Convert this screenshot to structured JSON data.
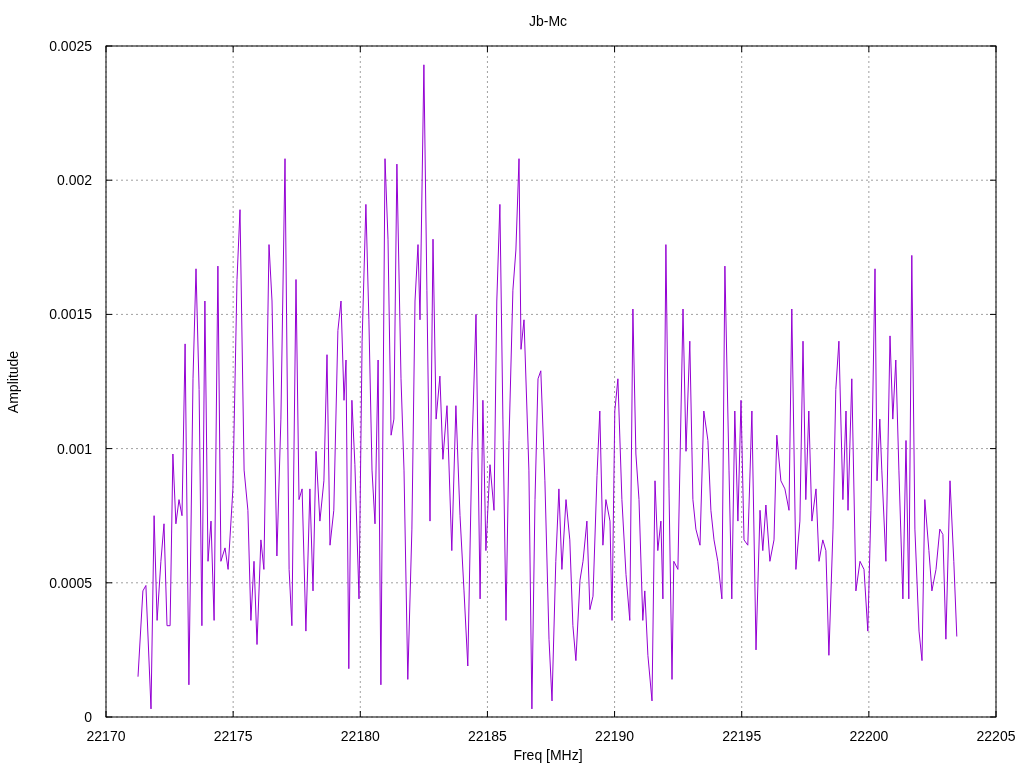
{
  "chart_data": {
    "type": "line",
    "title": "Jb-Mc",
    "xlabel": "Freq [MHz]",
    "ylabel": "Amplitude",
    "grid": true,
    "xlim": [
      22170,
      22205
    ],
    "ylim": [
      0,
      0.0025
    ],
    "xticks": [
      22170,
      22175,
      22180,
      22185,
      22190,
      22195,
      22200,
      22205
    ],
    "yticks": [
      0,
      0.0005,
      0.001,
      0.0015,
      0.002,
      0.0025
    ],
    "x": [
      22171.26,
      22171.45,
      22171.57,
      22171.77,
      22171.89,
      22172.01,
      22172.16,
      22172.28,
      22172.4,
      22172.52,
      22172.63,
      22172.75,
      22172.87,
      22172.99,
      22173.11,
      22173.26,
      22173.42,
      22173.54,
      22173.66,
      22173.77,
      22173.89,
      22174.01,
      22174.13,
      22174.25,
      22174.4,
      22174.52,
      22174.68,
      22174.8,
      22174.99,
      22175.15,
      22175.27,
      22175.43,
      22175.58,
      22175.7,
      22175.82,
      22175.94,
      22176.09,
      22176.21,
      22176.41,
      22176.53,
      22176.72,
      22176.88,
      22177.04,
      22177.2,
      22177.31,
      22177.47,
      22177.59,
      22177.71,
      22177.86,
      22178.02,
      22178.14,
      22178.26,
      22178.41,
      22178.57,
      22178.69,
      22178.81,
      22178.96,
      22179.12,
      22179.24,
      22179.36,
      22179.44,
      22179.55,
      22179.67,
      22179.79,
      22179.95,
      22180.07,
      22180.22,
      22180.34,
      22180.46,
      22180.58,
      22180.7,
      22180.81,
      22180.97,
      22181.09,
      22181.21,
      22181.32,
      22181.44,
      22181.6,
      22181.72,
      22181.87,
      22182.03,
      22182.15,
      22182.27,
      22182.35,
      22182.5,
      22182.62,
      22182.74,
      22182.86,
      22182.98,
      22183.13,
      22183.25,
      22183.41,
      22183.6,
      22183.76,
      22183.92,
      22184.08,
      22184.23,
      22184.39,
      22184.55,
      22184.71,
      22184.82,
      22184.94,
      22185.1,
      22185.26,
      22185.37,
      22185.49,
      22185.61,
      22185.73,
      22185.85,
      22186.0,
      22186.12,
      22186.24,
      22186.32,
      22186.44,
      22186.63,
      22186.75,
      22186.87,
      22186.99,
      22187.1,
      22187.26,
      22187.42,
      22187.54,
      22187.69,
      22187.81,
      22187.93,
      22188.09,
      22188.24,
      22188.36,
      22188.48,
      22188.64,
      22188.76,
      22188.91,
      22189.03,
      22189.15,
      22189.31,
      22189.42,
      22189.54,
      22189.66,
      22189.82,
      22189.9,
      22190.01,
      22190.13,
      22190.29,
      22190.45,
      22190.6,
      22190.72,
      22190.84,
      22190.96,
      22191.11,
      22191.19,
      22191.31,
      22191.47,
      22191.59,
      22191.7,
      22191.82,
      22191.9,
      22192.02,
      22192.14,
      22192.26,
      22192.33,
      22192.49,
      22192.69,
      22192.81,
      22192.96,
      22193.08,
      22193.2,
      22193.36,
      22193.51,
      22193.67,
      22193.79,
      22193.91,
      22194.06,
      22194.22,
      22194.34,
      22194.5,
      22194.61,
      22194.73,
      22194.85,
      22194.97,
      22195.09,
      22195.24,
      22195.4,
      22195.56,
      22195.72,
      22195.83,
      22195.95,
      22196.11,
      22196.27,
      22196.38,
      22196.54,
      22196.7,
      22196.86,
      22196.97,
      22197.13,
      22197.29,
      22197.41,
      22197.52,
      22197.64,
      22197.76,
      22197.92,
      22198.04,
      22198.19,
      22198.31,
      22198.43,
      22198.59,
      22198.7,
      22198.82,
      22198.98,
      22199.1,
      22199.18,
      22199.33,
      22199.49,
      22199.65,
      22199.81,
      22199.96,
      22200.08,
      22200.24,
      22200.32,
      22200.43,
      22200.51,
      22200.67,
      22200.83,
      22200.94,
      22201.06,
      22201.18,
      22201.34,
      22201.46,
      22201.57,
      22201.69,
      22201.81,
      22201.97,
      22202.09,
      22202.2,
      22202.36,
      22202.48,
      22202.64,
      22202.79,
      22202.91,
      22203.03,
      22203.19,
      22203.34,
      22203.46
    ],
    "series": [
      {
        "color": "#9400d3",
        "values": [
          0.00015,
          0.00047,
          0.00049,
          3e-05,
          0.00075,
          0.00036,
          0.00058,
          0.00072,
          0.00034,
          0.00034,
          0.00098,
          0.00072,
          0.00081,
          0.00075,
          0.00139,
          0.00012,
          0.00126,
          0.00167,
          0.00122,
          0.00034,
          0.00155,
          0.00058,
          0.00073,
          0.00036,
          0.00168,
          0.00058,
          0.00063,
          0.00055,
          0.00085,
          0.00163,
          0.00189,
          0.00092,
          0.00077,
          0.00036,
          0.00058,
          0.00027,
          0.00066,
          0.00055,
          0.00176,
          0.00155,
          0.0006,
          0.00111,
          0.00208,
          0.00055,
          0.00034,
          0.00163,
          0.00081,
          0.00085,
          0.00032,
          0.00085,
          0.00047,
          0.00099,
          0.00073,
          0.00088,
          0.00135,
          0.00064,
          0.00077,
          0.00144,
          0.00155,
          0.00118,
          0.00133,
          0.00018,
          0.00118,
          0.00094,
          0.00044,
          0.0014,
          0.00191,
          0.00148,
          0.00092,
          0.00072,
          0.00133,
          0.00012,
          0.00208,
          0.00178,
          0.00105,
          0.00111,
          0.00206,
          0.00126,
          0.00092,
          0.00014,
          0.0007,
          0.00155,
          0.00176,
          0.00148,
          0.00243,
          0.00159,
          0.00073,
          0.00178,
          0.00111,
          0.00127,
          0.00096,
          0.00116,
          0.00062,
          0.00116,
          0.00075,
          0.00047,
          0.00019,
          0.00099,
          0.0015,
          0.00044,
          0.00118,
          0.00062,
          0.00094,
          0.00077,
          0.00155,
          0.00191,
          0.00111,
          0.00036,
          0.00103,
          0.00159,
          0.00174,
          0.00208,
          0.00137,
          0.00148,
          0.00092,
          3e-05,
          0.00081,
          0.00126,
          0.00129,
          0.00088,
          0.00029,
          6e-05,
          0.00058,
          0.00085,
          0.00055,
          0.00081,
          0.00066,
          0.00034,
          0.00021,
          0.00051,
          0.00058,
          0.00073,
          0.0004,
          0.00045,
          0.0009,
          0.00114,
          0.00064,
          0.00081,
          0.00073,
          0.00036,
          0.00114,
          0.00126,
          0.00081,
          0.00053,
          0.00036,
          0.00152,
          0.00098,
          0.00081,
          0.00036,
          0.00047,
          0.00023,
          6e-05,
          0.00088,
          0.00062,
          0.00073,
          0.00044,
          0.00176,
          0.00085,
          0.00014,
          0.00058,
          0.00055,
          0.00152,
          0.00099,
          0.0014,
          0.00081,
          0.0007,
          0.00064,
          0.00114,
          0.00103,
          0.00077,
          0.00066,
          0.00058,
          0.00044,
          0.00168,
          0.00092,
          0.00044,
          0.00114,
          0.00073,
          0.00118,
          0.00066,
          0.00064,
          0.00114,
          0.00025,
          0.00077,
          0.00062,
          0.00079,
          0.00058,
          0.00066,
          0.00105,
          0.00088,
          0.00085,
          0.00077,
          0.00152,
          0.00055,
          0.00073,
          0.0014,
          0.00081,
          0.00114,
          0.00073,
          0.00085,
          0.00058,
          0.00066,
          0.00062,
          0.00023,
          0.0007,
          0.00122,
          0.0014,
          0.00081,
          0.00114,
          0.00077,
          0.00126,
          0.00047,
          0.00058,
          0.00055,
          0.00032,
          0.00077,
          0.00167,
          0.00088,
          0.00111,
          0.00092,
          0.00058,
          0.00142,
          0.00111,
          0.00133,
          0.00092,
          0.00044,
          0.00103,
          0.00044,
          0.00172,
          0.0007,
          0.00032,
          0.00021,
          0.00081,
          0.00062,
          0.00047,
          0.00055,
          0.0007,
          0.00068,
          0.00029,
          0.00088,
          0.00058,
          0.0003
        ]
      }
    ]
  }
}
